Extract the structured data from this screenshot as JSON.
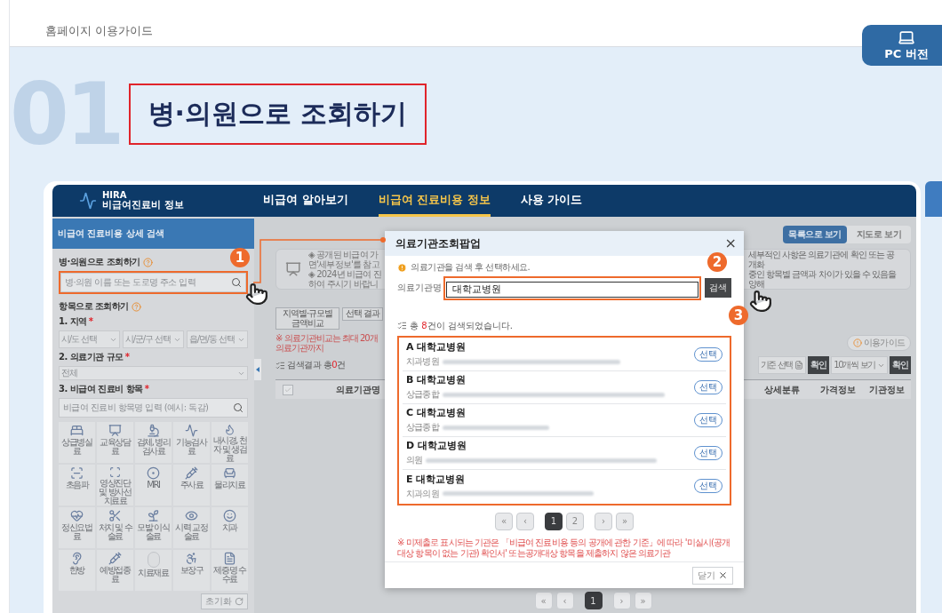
{
  "page": {
    "header": "홈페이지 이용가이드",
    "version_tab": "PC 버전"
  },
  "section": {
    "number": "01",
    "title": "병·의원으로 조회하기"
  },
  "app": {
    "logo": {
      "brand": "HIRA",
      "subtitle": "비급여진료비 정보"
    },
    "nav": [
      {
        "label": "비급여 알아보기",
        "selected": false
      },
      {
        "label": "비급여 진료비용 정보",
        "selected": true
      },
      {
        "label": "사용 가이드",
        "selected": false
      }
    ],
    "sidebar": {
      "title": "비급여 진료비용 상세 검색",
      "hospital_search": {
        "heading": "병·의원으로 조회하기",
        "placeholder": "병·의원 이름 또는 도로명 주소 입력"
      },
      "item_search": {
        "heading": "항목으로 조회하기",
        "region_label": {
          "text": "1. 지역",
          "required": "*"
        },
        "region_selects": [
          "시/도 선택",
          "시/군/구 선택",
          "읍/면/동 선택"
        ],
        "scale_label": {
          "text": "2. 의료기관 규모",
          "required": "*"
        },
        "scale_value": "전체",
        "item_label": {
          "text": "3. 비급여 진료비 항목",
          "required": "*"
        },
        "item_placeholder": "비급여 진료비 항목명 입력 (예시: 독감)",
        "categories": [
          "상급병실료",
          "교육상담료",
          "검체, 병리 검사료",
          "기능검사료",
          "내시경, 천자 및 생검료",
          "초음파",
          "영상진단 및 방사선치료료",
          "MRI",
          "주사료",
          "물리치료",
          "정신요법료",
          "처치 및 수술료",
          "모발 이식술료",
          "시력 교정술료",
          "치과",
          "한방",
          "예방접종료",
          "치료재료",
          "보장구",
          "제증명 수수료"
        ]
      },
      "reset": "초기화"
    },
    "view_tabs": [
      {
        "label": "목록으로 보기",
        "selected": true
      },
      {
        "label": "지도로 보기",
        "selected": false
      }
    ],
    "notice_left": [
      "◈ 공개된 비급여 가",
      "면'세부정보'를 참고",
      "◈ 2024년 비급여 진",
      "하여 주시기 바랍니"
    ],
    "notice_right": [
      "세부적인 사항은 의료기관에 확인 또는 공개화",
      "중인 항목별 금액과 차이가 있을 수 있음을 양해"
    ],
    "action_buttons": [
      "지역별·규모별 금액비교",
      "선택 결과"
    ],
    "compare_note": "※ 의료기관비교는 최대 20개 의료기관까지",
    "guide_button": "이용가이드",
    "column_select": "기준 선택",
    "select_all": {
      "checked": false
    },
    "confirm_buttons": [
      "확인",
      "확인"
    ],
    "page_size": "10개씩 보기",
    "result_summary": {
      "prefix": "검색결과 총",
      "count": "0",
      "suffix": "건"
    },
    "table_columns": [
      "의료기관명",
      "상세분류",
      "가격정보",
      "기관정보"
    ],
    "pager": {
      "first": "«",
      "prev": "‹",
      "pages": [
        {
          "label": "1",
          "selected": true
        }
      ],
      "next": "›",
      "last": "»"
    }
  },
  "popup": {
    "title": "의료기관조회팝업",
    "close": "×",
    "hint": "의료기관을 검색 후 선택하세요.",
    "field_label": "의료기관명",
    "field_value": "대학교병원",
    "search_button": "검색",
    "count": {
      "prefix": "총 ",
      "count": "8",
      "suffix": "건이 검색되었습니다."
    },
    "results": [
      {
        "name": "A 대학교병원",
        "type": "치과병원",
        "button": "선택"
      },
      {
        "name": "B 대학교병원",
        "type": "상급종합",
        "button": "선택"
      },
      {
        "name": "C 대학교병원",
        "type": "상급종합",
        "button": "선택"
      },
      {
        "name": "D 대학교병원",
        "type": "의원",
        "button": "선택"
      },
      {
        "name": "E 대학교병원",
        "type": "치과의원",
        "button": "선택"
      }
    ],
    "pager": {
      "first": "«",
      "prev": "‹",
      "pages": [
        {
          "label": "1",
          "selected": true
        },
        {
          "label": "2",
          "selected": false
        }
      ],
      "next": "›",
      "last": "»"
    },
    "note": "※ 미제출로 표시되는 기관은 「비급여 진료비용 등의 공개에 관한 기준」에 따라 '미실시(공개대상 항목이 없는 기관) 확인서' 또는공개대상 항목을 제출하지 않은 의료기관",
    "close_button": "닫기"
  },
  "annotations": [
    "1",
    "2",
    "3"
  ]
}
